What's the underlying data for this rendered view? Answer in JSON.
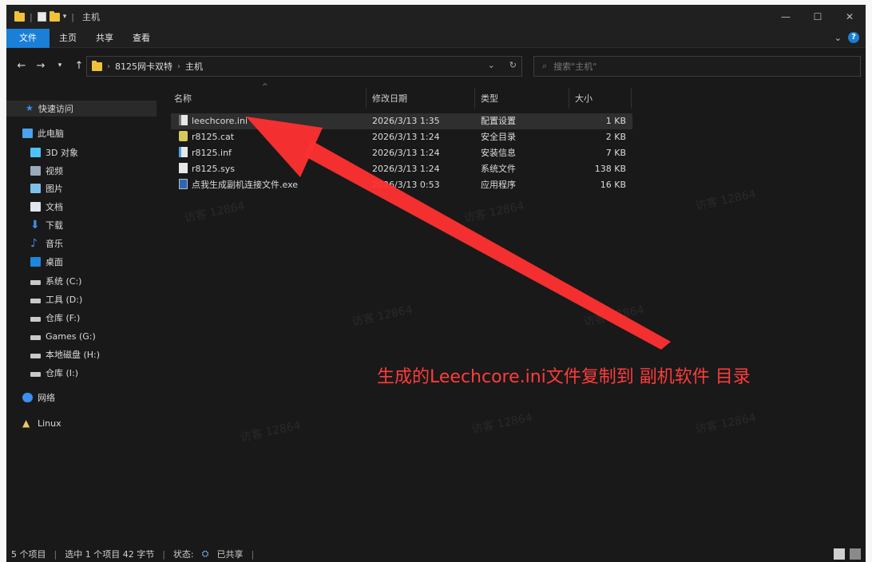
{
  "window": {
    "title": "主机"
  },
  "ribbon": {
    "tabs": [
      "文件",
      "主页",
      "共享",
      "查看"
    ]
  },
  "address": {
    "path": [
      "8125网卡双特",
      "主机"
    ],
    "search_placeholder": "搜索\"主机\""
  },
  "sidebar": {
    "quick_access": "快速访问",
    "items": [
      {
        "label": "此电脑",
        "icon": "pc-icon"
      },
      {
        "label": "3D 对象",
        "icon": "3d-objects-icon"
      },
      {
        "label": "视频",
        "icon": "video-icon"
      },
      {
        "label": "图片",
        "icon": "pictures-icon"
      },
      {
        "label": "文档",
        "icon": "documents-icon"
      },
      {
        "label": "下载",
        "icon": "download-icon"
      },
      {
        "label": "音乐",
        "icon": "music-icon"
      },
      {
        "label": "桌面",
        "icon": "desktop-icon"
      },
      {
        "label": "系统 (C:)",
        "icon": "drive-icon"
      },
      {
        "label": "工具 (D:)",
        "icon": "drive-icon"
      },
      {
        "label": "仓库 (F:)",
        "icon": "drive-icon"
      },
      {
        "label": "Games (G:)",
        "icon": "drive-icon"
      },
      {
        "label": "本地磁盘 (H:)",
        "icon": "drive-icon"
      },
      {
        "label": "仓库 (I:)",
        "icon": "drive-icon"
      },
      {
        "label": "网络",
        "icon": "network-icon"
      },
      {
        "label": "Linux",
        "icon": "linux-icon"
      }
    ]
  },
  "columns": {
    "name": "名称",
    "date": "修改日期",
    "type": "类型",
    "size": "大小"
  },
  "files": [
    {
      "name": "leechcore.ini",
      "date": "2026/3/13 1:35",
      "type": "配置设置",
      "size": "1 KB",
      "icon": "ini-file-icon"
    },
    {
      "name": "r8125.cat",
      "date": "2026/3/13 1:24",
      "type": "安全目录",
      "size": "2 KB",
      "icon": "cat-file-icon"
    },
    {
      "name": "r8125.inf",
      "date": "2026/3/13 1:24",
      "type": "安装信息",
      "size": "7 KB",
      "icon": "inf-file-icon"
    },
    {
      "name": "r8125.sys",
      "date": "2026/3/13 1:24",
      "type": "系统文件",
      "size": "138 KB",
      "icon": "sys-file-icon"
    },
    {
      "name": "点我生成副机连接文件.exe",
      "date": "2026/3/13 0:53",
      "type": "应用程序",
      "size": "16 KB",
      "icon": "exe-file-icon"
    }
  ],
  "status": {
    "count": "5 个项目",
    "selected": "选中 1 个项目  42 字节",
    "state": "状态:",
    "shared": "已共享"
  },
  "annotation": {
    "text": "生成的Leechcore.ini文件复制到 副机软件 目录",
    "color": "#ff3b3b"
  },
  "watermark": {
    "text": "访客 12864"
  }
}
